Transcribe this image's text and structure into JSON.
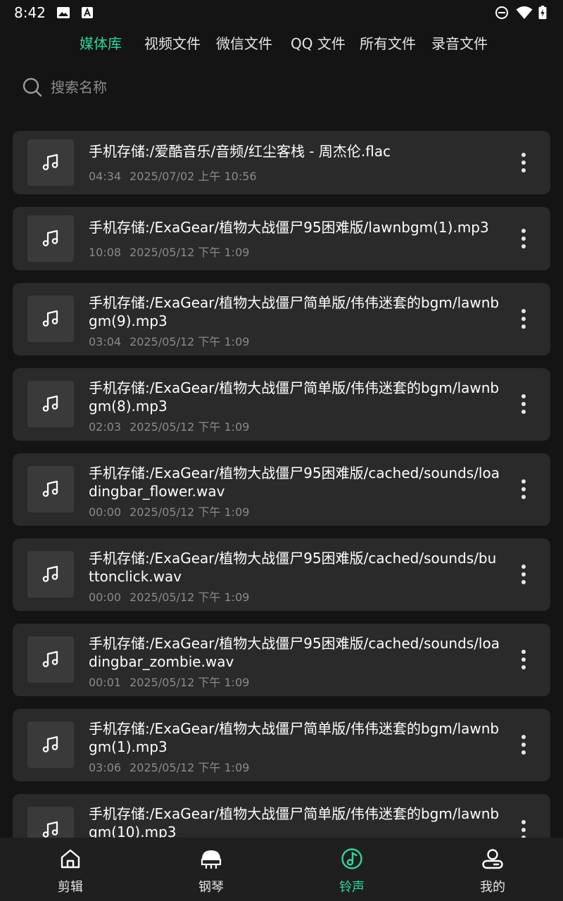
{
  "status_bar": {
    "time": "8:42"
  },
  "tabs": [
    {
      "label": "媒体库",
      "active": true
    },
    {
      "label": "视频文件",
      "active": false
    },
    {
      "label": "微信文件",
      "active": false
    },
    {
      "label": "QQ 文件",
      "active": false
    },
    {
      "label": "所有文件",
      "active": false
    },
    {
      "label": "录音文件",
      "active": false
    }
  ],
  "search": {
    "placeholder": "搜索名称",
    "value": ""
  },
  "files": [
    {
      "title": "手机存储:/爱酷音乐/音频/红尘客栈 - 周杰伦.flac",
      "duration": "04:34",
      "date": "2025/07/02 上午 10:56"
    },
    {
      "title": "手机存储:/ExaGear/植物大战僵尸95困难版/lawnbgm(1).mp3",
      "duration": "10:08",
      "date": "2025/05/12 下午 1:09"
    },
    {
      "title": "手机存储:/ExaGear/植物大战僵尸简单版/伟伟迷套的bgm/lawnbgm(9).mp3",
      "duration": "03:04",
      "date": "2025/05/12 下午 1:09"
    },
    {
      "title": "手机存储:/ExaGear/植物大战僵尸简单版/伟伟迷套的bgm/lawnbgm(8).mp3",
      "duration": "02:03",
      "date": "2025/05/12 下午 1:09"
    },
    {
      "title": "手机存储:/ExaGear/植物大战僵尸95困难版/cached/sounds/loadingbar_flower.wav",
      "duration": "00:00",
      "date": "2025/05/12 下午 1:09"
    },
    {
      "title": "手机存储:/ExaGear/植物大战僵尸95困难版/cached/sounds/buttonclick.wav",
      "duration": "00:00",
      "date": "2025/05/12 下午 1:09"
    },
    {
      "title": "手机存储:/ExaGear/植物大战僵尸95困难版/cached/sounds/loadingbar_zombie.wav",
      "duration": "00:01",
      "date": "2025/05/12 下午 1:09"
    },
    {
      "title": "手机存储:/ExaGear/植物大战僵尸简单版/伟伟迷套的bgm/lawnbgm(1).mp3",
      "duration": "03:06",
      "date": "2025/05/12 下午 1:09"
    },
    {
      "title": "手机存储:/ExaGear/植物大战僵尸简单版/伟伟迷套的bgm/lawnbgm(10).mp3",
      "duration": "",
      "date": ""
    }
  ],
  "bottom_nav": [
    {
      "label": "剪辑",
      "icon": "home-icon",
      "active": false
    },
    {
      "label": "钢琴",
      "icon": "piano-icon",
      "active": false
    },
    {
      "label": "铃声",
      "icon": "ringtone-music-icon",
      "active": true
    },
    {
      "label": "我的",
      "icon": "profile-icon",
      "active": false
    }
  ],
  "colors": {
    "accent": "#37d399",
    "background": "#141414",
    "card": "#2a2a2a",
    "thumb": "#3a3a3a",
    "meta_text": "#8a8a8a",
    "nav_bg": "#1f1f1f"
  }
}
